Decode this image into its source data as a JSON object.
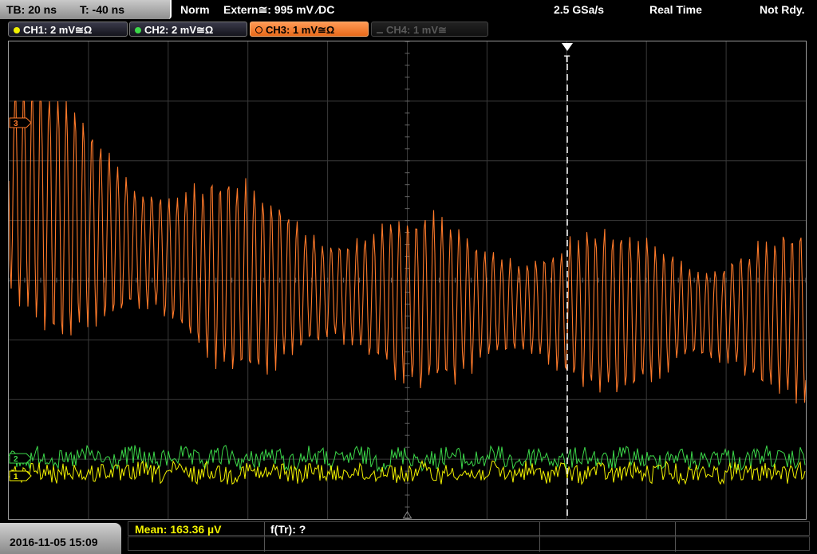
{
  "topbar": {
    "timebase": "TB: 20 ns",
    "trigger_offset": "T: -40 ns",
    "mode": "Norm",
    "trigger_source": "Extern≅: 995 mV ∕DC",
    "sample_rate": "2.5 GSa/s",
    "acq_mode": "Real Time",
    "status": "Not Rdy."
  },
  "channels": [
    {
      "label": "CH1: 2 mV≅Ω",
      "color": "#f2f200",
      "state": "on"
    },
    {
      "label": "CH2: 2 mV≅Ω",
      "color": "#3cd84a",
      "state": "on"
    },
    {
      "label": "CH3: 1 mV≅Ω",
      "color": "#ff7a2a",
      "state": "active"
    },
    {
      "label": "CH4: 1 mV≅",
      "color": "#5a5a5a",
      "state": "off"
    }
  ],
  "markers": {
    "ch3": "3",
    "ch2": "2",
    "ch1": "1",
    "trigger": "T"
  },
  "measurement": {
    "mean": "Mean: 163.36 µV",
    "ftr": "f(Tr): ?"
  },
  "datetime": "2016-11-05 15:09",
  "colors": {
    "ch1": "#f2f200",
    "ch2": "#3cd84a",
    "ch3": "#ff7a2a",
    "grid": "#3a3a3a"
  }
}
